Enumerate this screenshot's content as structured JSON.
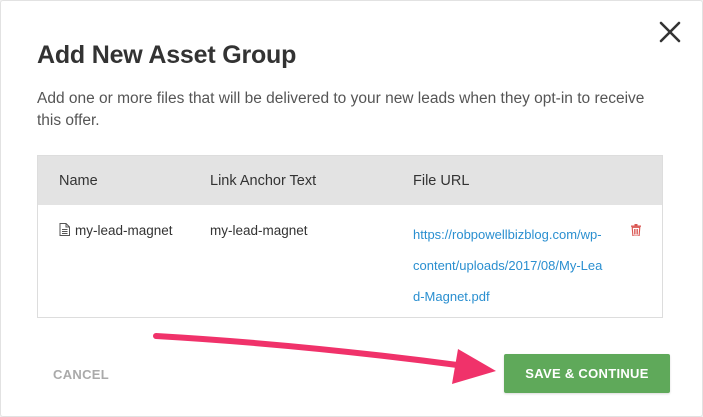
{
  "modal": {
    "title": "Add New Asset Group",
    "description": "Add one or more files that will be delivered to your new leads when they opt-in to receive this offer."
  },
  "table": {
    "headers": [
      "Name",
      "Link Anchor Text",
      "File URL"
    ],
    "rows": [
      {
        "name": "my-lead-magnet",
        "anchor_text": "my-lead-magnet",
        "file_url": "https://robpowellbizblog.com/wp-content/uploads/2017/08/My-Lead-Magnet.pdf"
      }
    ]
  },
  "actions": {
    "cancel_label": "CANCEL",
    "save_label": "SAVE & CONTINUE"
  },
  "colors": {
    "save_button": "#5fa95a",
    "link": "#2a8fd0",
    "trash_icon": "#d9534f",
    "arrow": "#f0326a"
  },
  "icons": [
    "close-icon",
    "file-icon",
    "trash-icon",
    "arrow-annotation"
  ]
}
